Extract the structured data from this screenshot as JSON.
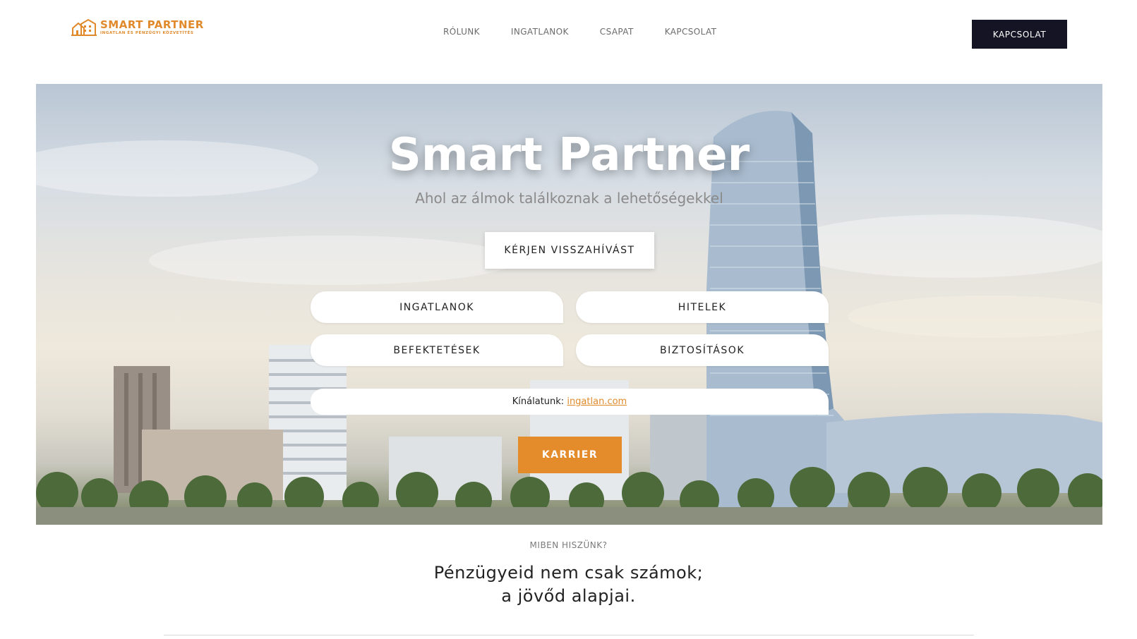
{
  "brand": {
    "name": "SMART PARTNER",
    "tagline": "INGATLAN ÉS PÉNZÜGYI KÖZVETÍTÉS",
    "color": "#e08a2c"
  },
  "nav": {
    "items": [
      {
        "label": "RÓLUNK"
      },
      {
        "label": "INGATLANOK"
      },
      {
        "label": "CSAPAT"
      },
      {
        "label": "KAPCSOLAT"
      }
    ],
    "cta_label": "KAPCSOLAT"
  },
  "hero": {
    "title": "Smart Partner",
    "subtitle": "Ahol az álmok találkoznak a lehetőségekkel",
    "callback_label": "KÉRJEN VISSZAHÍVÁST",
    "services": [
      "INGATLANOK",
      "HITELEK",
      "BEFEKTETÉSEK",
      "BIZTOSÍTÁSOK"
    ],
    "offer_prefix": "Kínálatunk:",
    "offer_link": "ingatlan.com",
    "career_label": "KARRIER"
  },
  "section": {
    "eyebrow": "MIBEN HISZÜNK?",
    "line1": "Pénzügyeid nem csak számok;",
    "line2": "a jövőd alapjai."
  },
  "colors": {
    "accent": "#e48b2c",
    "dark": "#151424"
  }
}
